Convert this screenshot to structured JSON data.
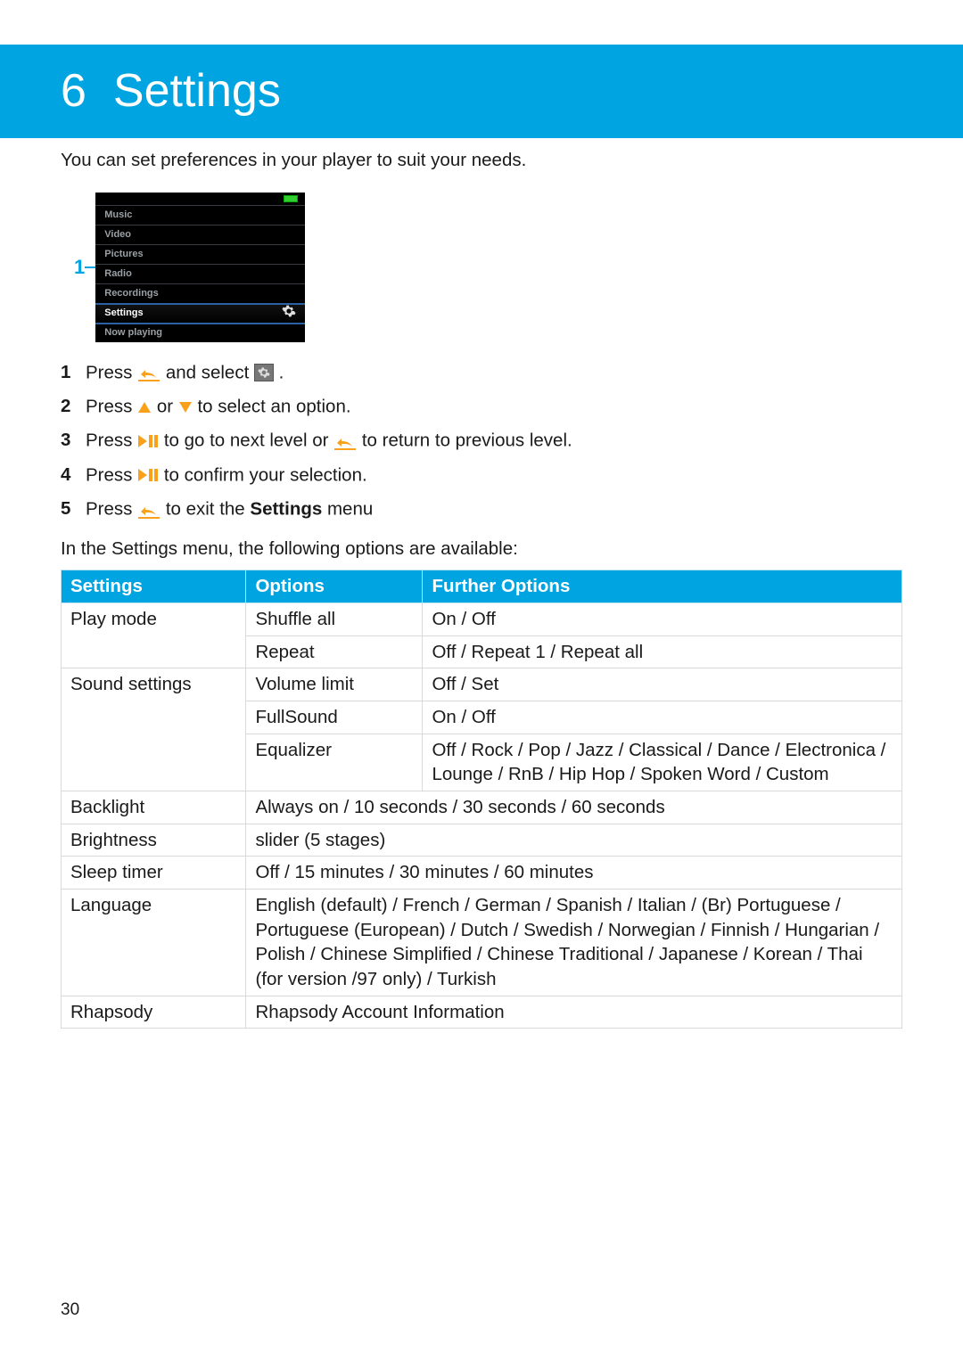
{
  "chapter": {
    "number": "6",
    "title": "Settings"
  },
  "intro": "You can set preferences in your player to suit your needs.",
  "callout": "1",
  "device_menu": [
    {
      "label": "Music"
    },
    {
      "label": "Video"
    },
    {
      "label": "Pictures"
    },
    {
      "label": "Radio"
    },
    {
      "label": "Recordings"
    },
    {
      "label": "Settings",
      "selected": true
    },
    {
      "label": "Now playing"
    }
  ],
  "steps": [
    {
      "n": "1",
      "pre": "Press ",
      "icon1": "back",
      "mid": " and select ",
      "icon2": "gear-box",
      "post": "."
    },
    {
      "n": "2",
      "pre": "Press ",
      "icon1": "up",
      "mid": " or ",
      "icon2": "down",
      "post": " to select an option."
    },
    {
      "n": "3",
      "pre": "Press ",
      "icon1": "playpause",
      "mid": " to go to next level or ",
      "icon2": "back",
      "post": " to return to previous level."
    },
    {
      "n": "4",
      "pre": "Press ",
      "icon1": "playpause",
      "post": " to confirm your selection."
    },
    {
      "n": "5",
      "pre": "Press ",
      "icon1": "back",
      "mid": " to exit the ",
      "bold": "Settings",
      "post": " menu"
    }
  ],
  "table_preface": "In the Settings menu, the following options are available:",
  "headers": {
    "settings": "Settings",
    "options": "Options",
    "further": "Further Options"
  },
  "rows": {
    "playmode": {
      "label": "Play mode",
      "r1_opt": "Shuffle all",
      "r1_more": "On / Off",
      "r2_opt": "Repeat",
      "r2_more": "Off / Repeat 1 / Repeat all"
    },
    "sound": {
      "label": "Sound settings",
      "r1_opt": "Volume limit",
      "r1_more": "Off / Set",
      "r2_opt": "FullSound",
      "r2_more": "On / Off",
      "r3_opt": "Equalizer",
      "r3_more": "Off / Rock / Pop / Jazz / Classical / Dance / Electronica / Lounge / RnB / Hip Hop / Spoken Word / Custom"
    },
    "backlight": {
      "label": "Backlight",
      "opt": "Always on / 10 seconds / 30 seconds / 60 seconds"
    },
    "brightness": {
      "label": "Brightness",
      "opt": "slider (5 stages)"
    },
    "sleep": {
      "label": "Sleep timer",
      "opt": "Off / 15 minutes / 30 minutes / 60 minutes"
    },
    "language": {
      "label": "Language",
      "opt": "English (default) / French / German / Spanish / Italian / (Br) Portuguese / Portuguese (European) / Dutch / Swedish / Norwegian / Finnish / Hungarian / Polish / Chinese Simplified / Chinese Traditional / Japanese / Korean / Thai (for version /97 only) / Turkish"
    },
    "rhapsody": {
      "label": "Rhapsody",
      "opt": "Rhapsody Account Information"
    }
  },
  "page_number": "30"
}
